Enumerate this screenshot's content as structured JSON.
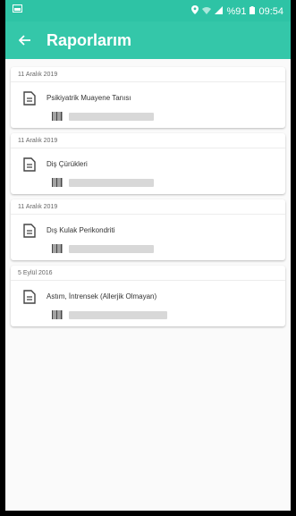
{
  "status_bar": {
    "battery": "%91",
    "time": "09:54"
  },
  "app_bar": {
    "title": "Raporlarım"
  },
  "reports": [
    {
      "date": "11 Aralık 2019",
      "diagnosis": "Psikiyatrik Muayene Tanısı"
    },
    {
      "date": "11 Aralık 2019",
      "diagnosis": "Diş Çürükleri"
    },
    {
      "date": "11 Aralık 2019",
      "diagnosis": "Dış Kulak Perikondriti"
    },
    {
      "date": "5 Eylül 2016",
      "diagnosis": "Astım, İntrensek (Allerjik Olmayan)"
    }
  ],
  "colors": {
    "accent": "#34c7a9"
  }
}
